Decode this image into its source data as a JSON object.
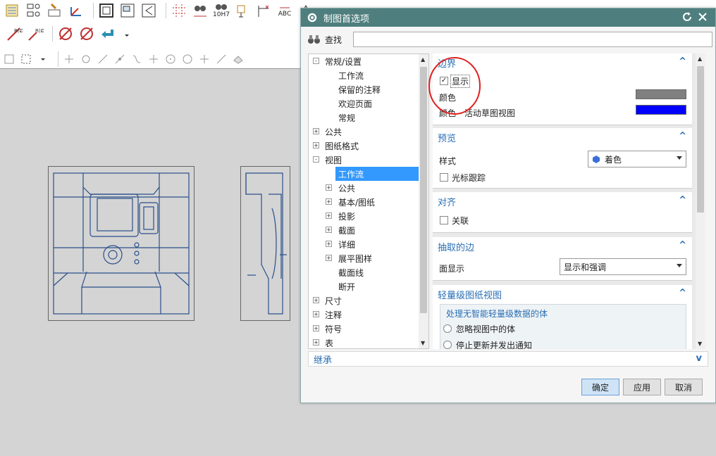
{
  "dialog": {
    "title": "制图首选项",
    "find_label": "查找",
    "find_value": "",
    "tree": [
      {
        "label": "常规/设置",
        "exp": "−",
        "level": 0
      },
      {
        "label": "工作流",
        "exp": "",
        "level": 1
      },
      {
        "label": "保留的注释",
        "exp": "",
        "level": 1
      },
      {
        "label": "欢迎页面",
        "exp": "",
        "level": 1
      },
      {
        "label": "常规",
        "exp": "",
        "level": 1
      },
      {
        "label": "公共",
        "exp": "+",
        "level": 0
      },
      {
        "label": "图纸格式",
        "exp": "+",
        "level": 0
      },
      {
        "label": "视图",
        "exp": "−",
        "level": 0
      },
      {
        "label": "工作流",
        "exp": "",
        "level": 1,
        "selected": true
      },
      {
        "label": "公共",
        "exp": "+",
        "level": 1
      },
      {
        "label": "基本/图纸",
        "exp": "+",
        "level": 1
      },
      {
        "label": "投影",
        "exp": "+",
        "level": 1
      },
      {
        "label": "截面",
        "exp": "+",
        "level": 1
      },
      {
        "label": "详细",
        "exp": "+",
        "level": 1
      },
      {
        "label": "展平图样",
        "exp": "+",
        "level": 1
      },
      {
        "label": "截面线",
        "exp": "",
        "level": 1
      },
      {
        "label": "断开",
        "exp": "",
        "level": 1
      },
      {
        "label": "尺寸",
        "exp": "+",
        "level": 0
      },
      {
        "label": "注释",
        "exp": "+",
        "level": 0
      },
      {
        "label": "符号",
        "exp": "+",
        "level": 0
      },
      {
        "label": "表",
        "exp": "+",
        "level": 0
      }
    ],
    "inherit_label": "继承",
    "groups": {
      "border": {
        "title": "边界",
        "show_label": "显示",
        "show_checked": true,
        "color_label": "颜色",
        "color": "#808080",
        "active_color_label": "颜色 - 活动草图视图",
        "active_color": "#0000ff"
      },
      "preview": {
        "title": "预览",
        "style_label": "样式",
        "style_value": "着色",
        "cursor_label": "光标跟踪"
      },
      "align": {
        "title": "对齐",
        "assoc_label": "关联"
      },
      "extracted": {
        "title": "抽取的边",
        "face_label": "面显示",
        "face_value": "显示和强调"
      },
      "lightweight": {
        "title": "轻量级图纸视图",
        "sub_title": "处理无智能轻量级数据的体",
        "opt1": "忽略视图中的体",
        "opt2": "停止更新并发出通知"
      }
    },
    "buttons": {
      "ok": "确定",
      "apply": "应用",
      "cancel": "取消"
    }
  },
  "toolbar": {
    "abc_label": "ABC",
    "h7_label": "10H7",
    "r0_label": "R(Ø)"
  },
  "colors": {
    "title_bar": "#4f7e7e",
    "accent": "#2a6fb4",
    "selection": "#3399ff",
    "highlight_circle": "#e02020"
  }
}
